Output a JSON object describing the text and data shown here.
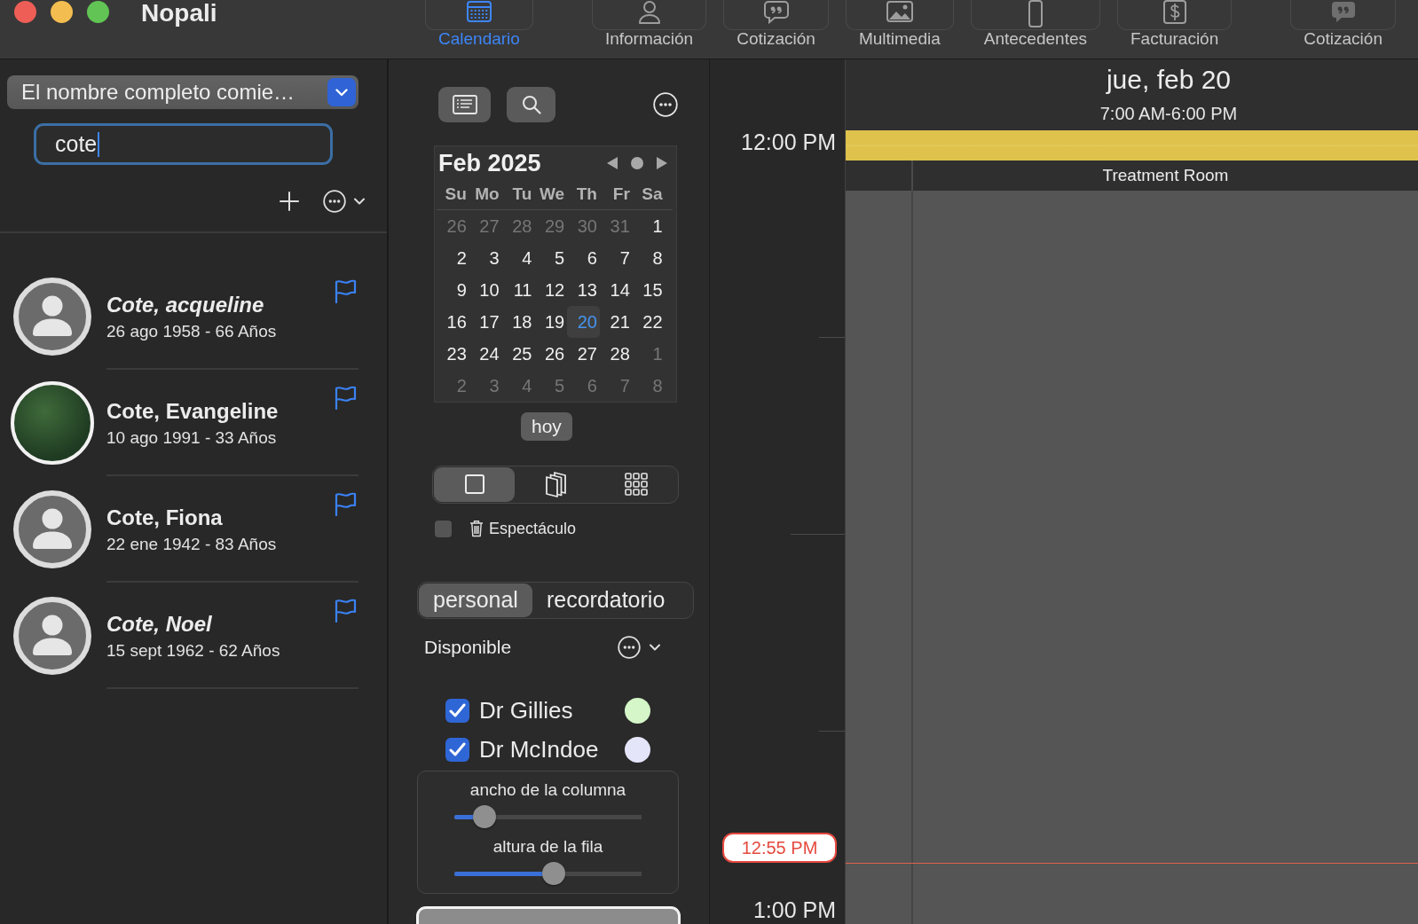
{
  "window": {
    "title": "Nopali"
  },
  "toolbar": {
    "tabs": [
      {
        "label": "Calendario",
        "selected": true
      },
      {
        "label": "Información",
        "selected": false
      },
      {
        "label": "Cotización",
        "selected": false
      },
      {
        "label": "Multimedia",
        "selected": false
      },
      {
        "label": "Antecedentes",
        "selected": false
      },
      {
        "label": "Facturación",
        "selected": false
      },
      {
        "label": "Cotización",
        "selected": false
      }
    ]
  },
  "search": {
    "filter": "El nombre completo comie…",
    "value": "cote"
  },
  "patients": [
    {
      "name": "Cote, acqueline",
      "details": "26 ago 1958 - 66 Años",
      "kind": "silhouette",
      "italic": true,
      "flagged": true
    },
    {
      "name": "Cote, Evangeline",
      "details": "10 ago 1991 - 33 Años",
      "kind": "photo",
      "italic": false,
      "flagged": true
    },
    {
      "name": "Cote, Fiona",
      "details": "22 ene 1942 - 83 Años",
      "kind": "silhouette",
      "italic": false,
      "flagged": true
    },
    {
      "name": "Cote, Noel",
      "details": "15 sept 1962 - 62 Años",
      "kind": "silhouette",
      "italic": true,
      "flagged": true
    }
  ],
  "mini_calendar": {
    "title": "Feb 2025",
    "weekdays": [
      "Su",
      "Mo",
      "Tu",
      "We",
      "Th",
      "Fr",
      "Sa"
    ],
    "weeks": [
      [
        {
          "day": "26",
          "outside": true,
          "selected": false
        },
        {
          "day": "27",
          "outside": true,
          "selected": false
        },
        {
          "day": "28",
          "outside": true,
          "selected": false
        },
        {
          "day": "29",
          "outside": true,
          "selected": false
        },
        {
          "day": "30",
          "outside": true,
          "selected": false
        },
        {
          "day": "31",
          "outside": true,
          "selected": false
        },
        {
          "day": "1",
          "outside": false,
          "selected": false
        }
      ],
      [
        {
          "day": "2",
          "outside": false,
          "selected": false
        },
        {
          "day": "3",
          "outside": false,
          "selected": false
        },
        {
          "day": "4",
          "outside": false,
          "selected": false
        },
        {
          "day": "5",
          "outside": false,
          "selected": false
        },
        {
          "day": "6",
          "outside": false,
          "selected": false
        },
        {
          "day": "7",
          "outside": false,
          "selected": false
        },
        {
          "day": "8",
          "outside": false,
          "selected": false
        }
      ],
      [
        {
          "day": "9",
          "outside": false,
          "selected": false
        },
        {
          "day": "10",
          "outside": false,
          "selected": false
        },
        {
          "day": "11",
          "outside": false,
          "selected": false
        },
        {
          "day": "12",
          "outside": false,
          "selected": false
        },
        {
          "day": "13",
          "outside": false,
          "selected": false
        },
        {
          "day": "14",
          "outside": false,
          "selected": false
        },
        {
          "day": "15",
          "outside": false,
          "selected": false
        }
      ],
      [
        {
          "day": "16",
          "outside": false,
          "selected": false
        },
        {
          "day": "17",
          "outside": false,
          "selected": false
        },
        {
          "day": "18",
          "outside": false,
          "selected": false
        },
        {
          "day": "19",
          "outside": false,
          "selected": false
        },
        {
          "day": "20",
          "outside": false,
          "selected": true
        },
        {
          "day": "21",
          "outside": false,
          "selected": false
        },
        {
          "day": "22",
          "outside": false,
          "selected": false
        }
      ],
      [
        {
          "day": "23",
          "outside": false,
          "selected": false
        },
        {
          "day": "24",
          "outside": false,
          "selected": false
        },
        {
          "day": "25",
          "outside": false,
          "selected": false
        },
        {
          "day": "26",
          "outside": false,
          "selected": false
        },
        {
          "day": "27",
          "outside": false,
          "selected": false
        },
        {
          "day": "28",
          "outside": false,
          "selected": false
        },
        {
          "day": "1",
          "outside": true,
          "selected": false
        }
      ],
      [
        {
          "day": "2",
          "outside": true,
          "selected": false
        },
        {
          "day": "3",
          "outside": true,
          "selected": false
        },
        {
          "day": "4",
          "outside": true,
          "selected": false
        },
        {
          "day": "5",
          "outside": true,
          "selected": false
        },
        {
          "day": "6",
          "outside": true,
          "selected": false
        },
        {
          "day": "7",
          "outside": true,
          "selected": false
        },
        {
          "day": "8",
          "outside": true,
          "selected": false
        }
      ]
    ],
    "today_button": "hoy"
  },
  "view_modes": [
    {
      "selected": true
    },
    {
      "selected": false
    },
    {
      "selected": false
    }
  ],
  "show_option": {
    "label": "Espectáculo",
    "checked": false
  },
  "segments": [
    {
      "label": "personal",
      "selected": true
    },
    {
      "label": "recordatorio",
      "selected": false
    }
  ],
  "availability": {
    "label": "Disponible"
  },
  "providers": [
    {
      "name": "Dr Gillies",
      "checked": true,
      "color": "#d4f6c8"
    },
    {
      "name": "Dr McIndoe",
      "checked": true,
      "color": "#e5e5fa"
    }
  ],
  "sliders": [
    {
      "label": "ancho de la columna",
      "level": 0.16
    },
    {
      "label": "altura de la fila",
      "level": 0.53
    }
  ],
  "day_view": {
    "date": "jue, feb 20",
    "hours": "7:00 AM-6:00 PM",
    "resource": "Treatment Room",
    "time_labels": [
      "12:00 PM",
      "1:00 PM"
    ],
    "now": "12:55 PM"
  }
}
